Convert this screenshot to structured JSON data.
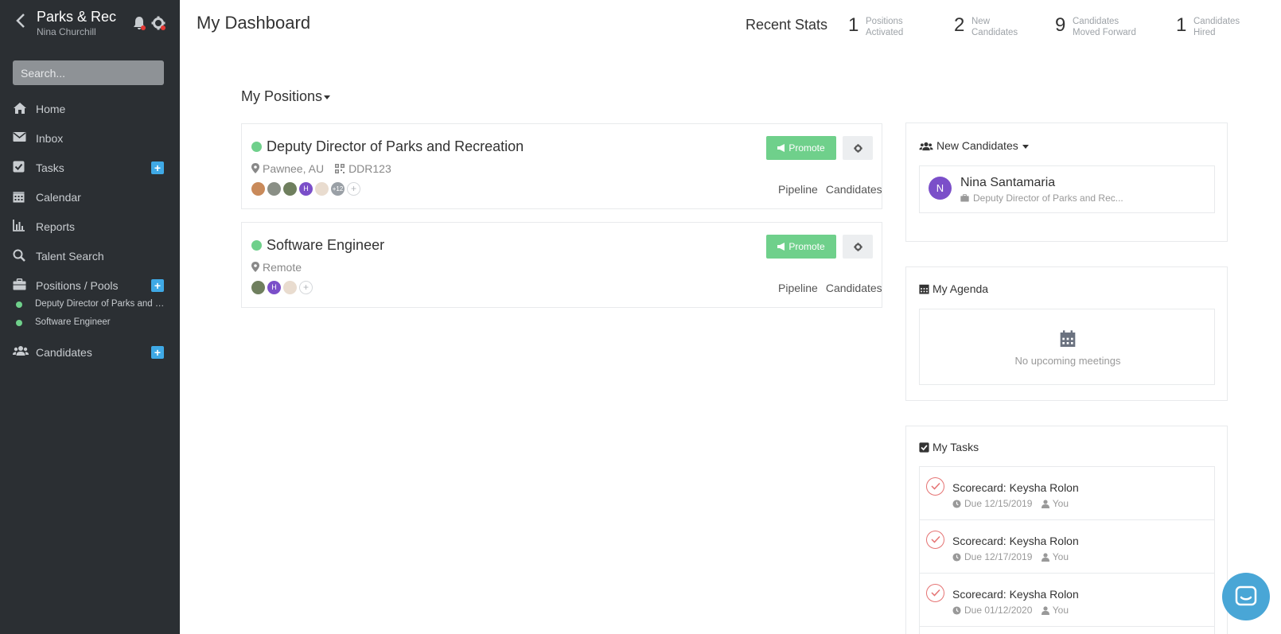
{
  "sidebar": {
    "org_name": "Parks & Rec",
    "user_name": "Nina Churchill",
    "search_placeholder": "Search...",
    "items": [
      {
        "label": "Home",
        "icon": "home-icon"
      },
      {
        "label": "Inbox",
        "icon": "envelope-icon"
      },
      {
        "label": "Tasks",
        "icon": "check-square-icon",
        "plus": "+"
      },
      {
        "label": "Calendar",
        "icon": "calendar-icon"
      },
      {
        "label": "Reports",
        "icon": "bar-chart-icon"
      },
      {
        "label": "Talent Search",
        "icon": "search-icon"
      },
      {
        "label": "Positions / Pools",
        "icon": "briefcase-icon",
        "plus": "+"
      },
      {
        "label": "Candidates",
        "icon": "users-icon",
        "plus": "+"
      }
    ],
    "sub_items": [
      {
        "label": "Deputy Director of Parks and Recreation"
      },
      {
        "label": "Software Engineer"
      }
    ]
  },
  "header": {
    "title": "My Dashboard",
    "stats_title": "Recent Stats",
    "stats": [
      {
        "value": "1",
        "label_line1": "Positions",
        "label_line2": "Activated"
      },
      {
        "value": "2",
        "label_line1": "New",
        "label_line2": "Candidates"
      },
      {
        "value": "9",
        "label_line1": "Candidates",
        "label_line2": "Moved Forward"
      },
      {
        "value": "1",
        "label_line1": "Candidates",
        "label_line2": "Hired"
      }
    ]
  },
  "positions": {
    "header": "My Positions",
    "cards": [
      {
        "title": "Deputy Director of Parks and Recreation",
        "location": "Pawnee, AU",
        "code": "DDR123",
        "more_count": "+12",
        "add": "+",
        "avatar_letter": "H",
        "promote_label": "Promote",
        "pipeline_label": "Pipeline",
        "candidates_label": "Candidates"
      },
      {
        "title": "Software Engineer",
        "location": "Remote",
        "add": "+",
        "avatar_letter": "H",
        "promote_label": "Promote",
        "pipeline_label": "Pipeline",
        "candidates_label": "Candidates"
      }
    ]
  },
  "new_candidates": {
    "title": "New Candidates",
    "items": [
      {
        "initial": "N",
        "name": "Nina Santamaria",
        "position": "Deputy Director of Parks and Rec..."
      }
    ]
  },
  "agenda": {
    "title": "My Agenda",
    "empty_text": "No upcoming meetings"
  },
  "tasks": {
    "title": "My Tasks",
    "items": [
      {
        "name": "Scorecard: Keysha Rolon",
        "due": "Due 12/15/2019",
        "owner": "You"
      },
      {
        "name": "Scorecard: Keysha Rolon",
        "due": "Due 12/17/2019",
        "owner": "You"
      },
      {
        "name": "Scorecard: Keysha Rolon",
        "due": "Due 01/12/2020",
        "owner": "You"
      }
    ]
  },
  "colors": {
    "sidebar_bg": "#2b2f33",
    "accent_green": "#6fd08b",
    "accent_blue": "#3fa9e6",
    "avatar_purple": "#7b4fc9",
    "alert_red": "#e53935"
  }
}
